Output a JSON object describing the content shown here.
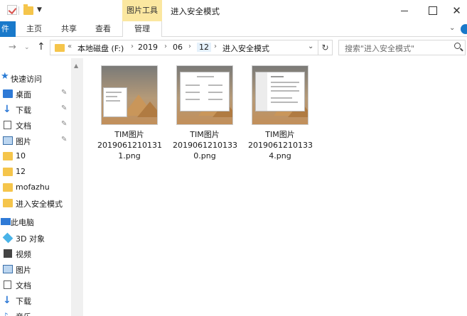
{
  "titlebar": {
    "context_tab": "图片工具",
    "window_title": "进入安全模式",
    "close_glyph": "✕"
  },
  "ribbon": {
    "tabs": [
      "件",
      "主页",
      "共享",
      "查看",
      "管理"
    ]
  },
  "address": {
    "back": "→",
    "up": "↑",
    "overflow": "«",
    "crumbs": [
      "本地磁盘 (F:)",
      "2019",
      "06",
      "12",
      "进入安全模式"
    ],
    "search_placeholder": "搜索\"进入安全模式\""
  },
  "sidebar": {
    "items": [
      {
        "label": "快速访问",
        "icon": "star-icon",
        "pinned": false
      },
      {
        "label": "桌面",
        "icon": "desktop-icon",
        "pinned": true
      },
      {
        "label": "下载",
        "icon": "download-icon",
        "pinned": true
      },
      {
        "label": "文档",
        "icon": "document-icon",
        "pinned": true
      },
      {
        "label": "图片",
        "icon": "pictures-icon",
        "pinned": true
      },
      {
        "label": "10",
        "icon": "folder-icon",
        "pinned": false
      },
      {
        "label": "12",
        "icon": "folder-icon",
        "pinned": false
      },
      {
        "label": "mofazhu",
        "icon": "folder-icon",
        "pinned": false
      },
      {
        "label": "进入安全模式",
        "icon": "folder-icon",
        "pinned": false
      },
      {
        "label": "此电脑",
        "icon": "computer-icon",
        "pinned": false
      },
      {
        "label": "3D 对象",
        "icon": "3d-objects-icon",
        "pinned": false
      },
      {
        "label": "视频",
        "icon": "video-icon",
        "pinned": false
      },
      {
        "label": "图片",
        "icon": "pictures-icon",
        "pinned": false
      },
      {
        "label": "文档",
        "icon": "document-icon",
        "pinned": false
      },
      {
        "label": "下载",
        "icon": "download-icon",
        "pinned": false
      },
      {
        "label": "音乐",
        "icon": "music-icon",
        "pinned": false
      }
    ]
  },
  "files": [
    {
      "name_line1": "TIM图片",
      "name_line2": "2019061210131",
      "name_line3": "1.png"
    },
    {
      "name_line1": "TIM图片",
      "name_line2": "2019061210133",
      "name_line3": "0.png"
    },
    {
      "name_line1": "TIM图片",
      "name_line2": "2019061210133",
      "name_line3": "4.png"
    }
  ],
  "colors": {
    "accent": "#1979ca",
    "context_tab": "#fbe7a0",
    "folder": "#f5c54b"
  }
}
